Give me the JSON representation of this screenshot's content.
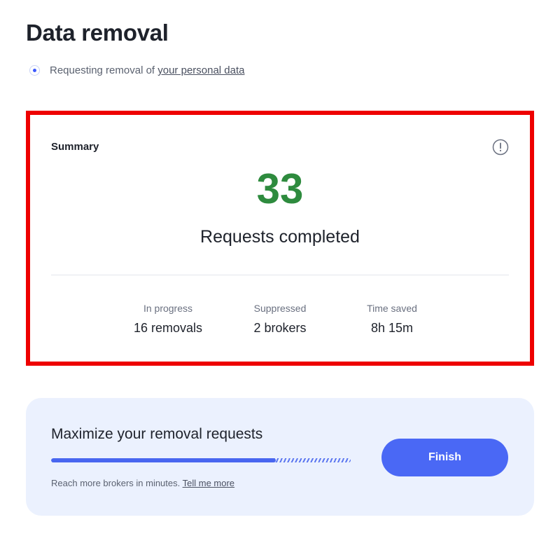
{
  "page": {
    "title": "Data removal",
    "status_text": "Requesting removal of ",
    "status_link": "your personal data"
  },
  "summary": {
    "heading": "Summary",
    "info_icon": "info-circle-icon",
    "count": "33",
    "count_caption": "Requests completed",
    "stats": [
      {
        "label": "In progress",
        "value": "16 removals"
      },
      {
        "label": "Suppressed",
        "value": "2 brokers"
      },
      {
        "label": "Time saved",
        "value": "8h 15m"
      }
    ],
    "count_color": "#2e8b3e",
    "highlight_border_color": "#ee0000"
  },
  "promo": {
    "title": "Maximize your removal requests",
    "progress_fraction": 0.75,
    "text": "Reach more brokers in minutes. ",
    "link": "Tell me more",
    "button_label": "Finish",
    "accent_color": "#4a68f5"
  }
}
